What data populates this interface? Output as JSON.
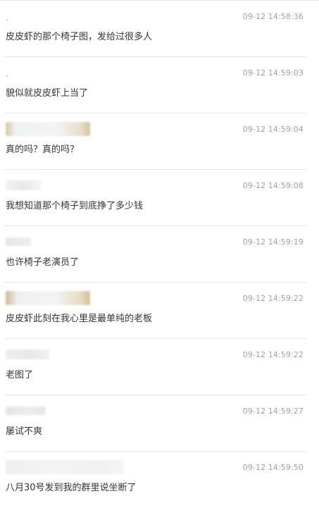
{
  "comments": [
    {
      "user": ".",
      "time": "09-12 14:58:36",
      "text": "皮皮虾的那个椅子图，发给过很多人"
    },
    {
      "user": ".",
      "time": "09-12 14:59:03",
      "text": "貌似就皮皮虾上当了"
    },
    {
      "user": "",
      "time": "09-12 14:59:04",
      "text": "真的吗？真的吗？"
    },
    {
      "user": "",
      "time": "09-12 14:59:08",
      "text": "我想知道那个椅子到底挣了多少钱"
    },
    {
      "user": "",
      "time": "09-12 14:59:19",
      "text": "也许椅子老演员了"
    },
    {
      "user": "",
      "time": "09-12 14:59:22",
      "text": "皮皮虾此刻在我心里是最单纯的老板"
    },
    {
      "user": "",
      "time": "09-12 14:59:22",
      "text": "老图了"
    },
    {
      "user": "",
      "time": "09-12 14:59:27",
      "text": "屡试不爽"
    },
    {
      "user": "",
      "time": "09-12 14:59:50",
      "text": "八月30号发到我的群里说坐断了"
    }
  ]
}
